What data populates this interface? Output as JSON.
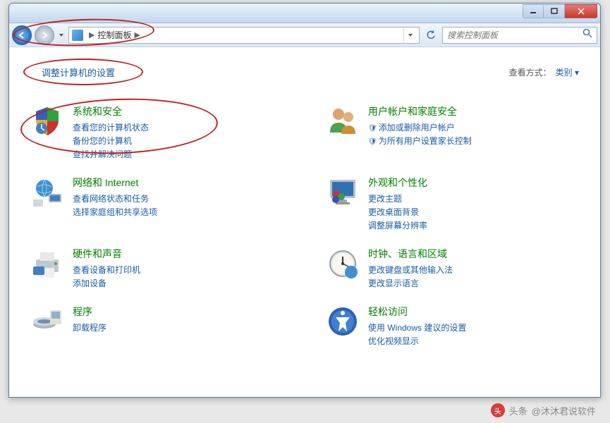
{
  "titlebar": {},
  "nav": {
    "breadcrumb_root": "控制面板",
    "search_placeholder": "搜索控制面板"
  },
  "header": {
    "title": "调整计算机的设置",
    "view_label": "查看方式：",
    "view_value": "类别"
  },
  "categories": [
    {
      "title": "系统和安全",
      "links": [
        "查看您的计算机状态",
        "备份您的计算机",
        "查找并解决问题"
      ],
      "highlighted": true
    },
    {
      "title": "用户帐户和家庭安全",
      "links": [
        "添加或删除用户帐户",
        "为所有用户设置家长控制"
      ],
      "shields": [
        true,
        true
      ]
    },
    {
      "title": "网络和 Internet",
      "links": [
        "查看网络状态和任务",
        "选择家庭组和共享选项"
      ]
    },
    {
      "title": "外观和个性化",
      "links": [
        "更改主题",
        "更改桌面背景",
        "调整屏幕分辨率"
      ]
    },
    {
      "title": "硬件和声音",
      "links": [
        "查看设备和打印机",
        "添加设备"
      ]
    },
    {
      "title": "时钟、语言和区域",
      "links": [
        "更改键盘或其他输入法",
        "更改显示语言"
      ]
    },
    {
      "title": "程序",
      "links": [
        "卸载程序"
      ]
    },
    {
      "title": "轻松访问",
      "links": [
        "使用 Windows 建议的设置",
        "优化视频显示"
      ]
    }
  ],
  "watermark": {
    "prefix": "头条",
    "text": "@沐沐君说软件"
  }
}
